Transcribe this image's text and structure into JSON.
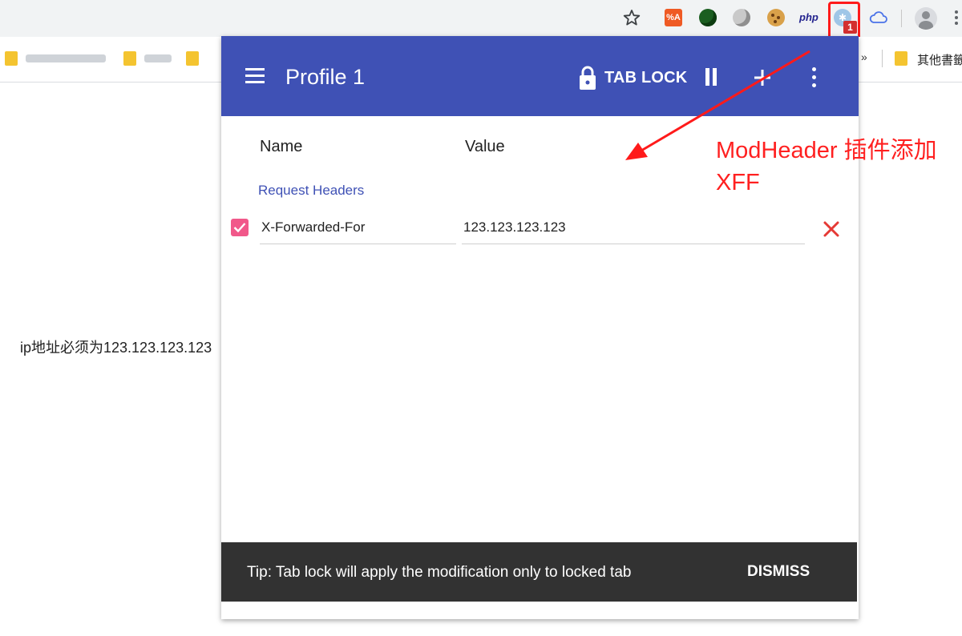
{
  "browser": {
    "extensions": [
      {
        "name": "fa-translate-extension",
        "label": "%A"
      },
      {
        "name": "green-extension",
        "label": ""
      },
      {
        "name": "globe-extension",
        "label": ""
      },
      {
        "name": "cookie-extension",
        "label": ""
      },
      {
        "name": "php-extension",
        "label": "php"
      },
      {
        "name": "modheader-extension",
        "label": "",
        "badge": "1"
      },
      {
        "name": "cloud-extension",
        "label": ""
      }
    ],
    "colors": {
      "toolbar": "#f1f3f4",
      "highlight": "#ff1a1a"
    }
  },
  "bookmarks": {
    "overflow": "»",
    "other_label": "其他書籤"
  },
  "page": {
    "message": "ip地址必须为123.123.123.123"
  },
  "popup": {
    "title": "Profile 1",
    "tab_lock_label": "TAB LOCK",
    "columns": {
      "name": "Name",
      "value": "Value"
    },
    "section": "Request Headers",
    "headers": [
      {
        "enabled": true,
        "name": "X-Forwarded-For",
        "value": "123.123.123.123"
      }
    ],
    "snackbar": {
      "tip": "Tip: Tab lock will apply the modification only to locked tab",
      "action": "DISMISS"
    },
    "colors": {
      "appbar": "#3f51b5",
      "checkbox": "#f1588a",
      "delete": "#e53935",
      "snackbar": "#323232"
    }
  },
  "annotation": {
    "line1": "ModHeader 插件添加",
    "line2": "XFF",
    "color": "#ff2020"
  }
}
